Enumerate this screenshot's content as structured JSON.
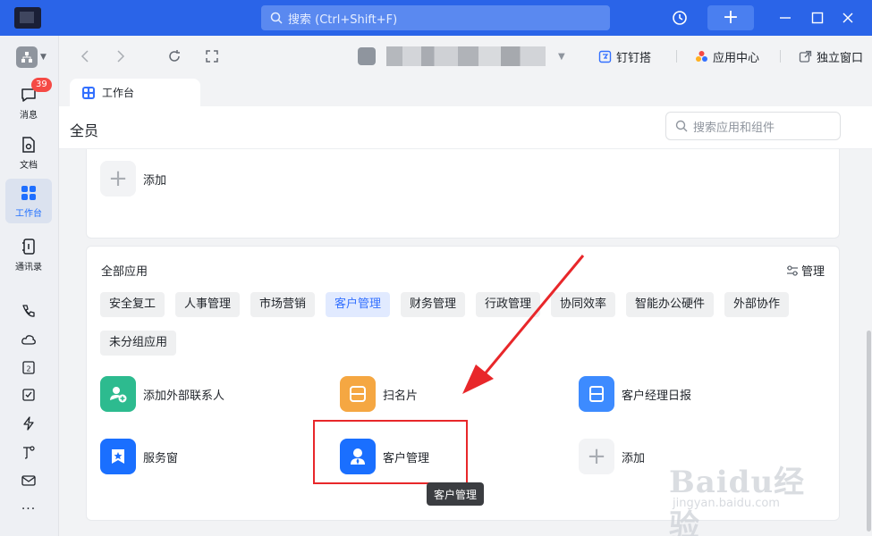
{
  "titlebar": {
    "search_placeholder": "搜索 (Ctrl+Shift+F)"
  },
  "leftnav": {
    "items": [
      {
        "label": "消息",
        "icon": "message-icon",
        "badge": "39"
      },
      {
        "label": "文档",
        "icon": "document-icon"
      },
      {
        "label": "工作台",
        "icon": "workbench-icon",
        "active": true
      },
      {
        "label": "通讯录",
        "icon": "contacts-icon"
      }
    ],
    "more": "···"
  },
  "toolbar": {
    "dingdingda": "钉钉搭",
    "app_center": "应用中心",
    "standalone_window": "独立窗口"
  },
  "tab": {
    "label": "工作台"
  },
  "page": {
    "title": "全员",
    "search_placeholder": "搜索应用和组件",
    "top_add": "添加",
    "all_apps": {
      "title": "全部应用",
      "manage": "管理",
      "categories": [
        "安全复工",
        "人事管理",
        "市场营销",
        "客户管理",
        "财务管理",
        "行政管理",
        "协同效率",
        "智能办公硬件",
        "外部协作",
        "未分组应用"
      ],
      "active_category": "客户管理",
      "apps": [
        {
          "label": "添加外部联系人",
          "icon": "add-contact-icon",
          "color": "#2dbb8f"
        },
        {
          "label": "扫名片",
          "icon": "scan-card-icon",
          "color": "#f5a742"
        },
        {
          "label": "客户经理日报",
          "icon": "daily-report-icon",
          "color": "#3d8bff"
        },
        {
          "label": "服务窗",
          "icon": "service-window-icon",
          "color": "#1a6fff"
        },
        {
          "label": "客户管理",
          "icon": "customer-icon",
          "color": "#1a6fff"
        },
        {
          "label": "添加",
          "icon": "plus-icon"
        }
      ]
    }
  },
  "tooltip": "客户管理",
  "watermark": {
    "brand": "Baidu经验",
    "url": "jingyan.baidu.com"
  },
  "colors": {
    "titlebar": "#2a64e8",
    "accent": "#3370ff",
    "highlight": "#e8272a"
  }
}
